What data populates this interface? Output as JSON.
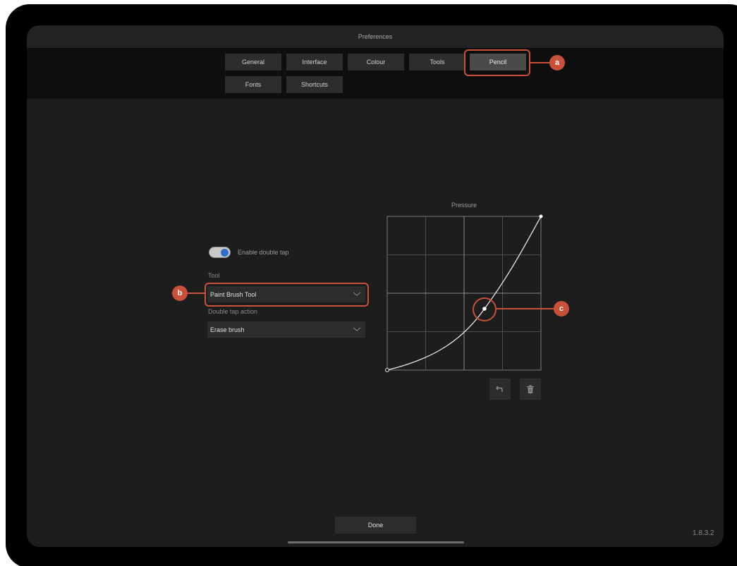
{
  "window": {
    "title": "Preferences"
  },
  "tabs": [
    {
      "label": "General"
    },
    {
      "label": "Interface"
    },
    {
      "label": "Colour"
    },
    {
      "label": "Tools"
    },
    {
      "label": "Pencil",
      "active": true
    },
    {
      "label": "Fonts"
    },
    {
      "label": "Shortcuts"
    }
  ],
  "callouts": {
    "a": "a",
    "b": "b",
    "c": "c",
    "color": "#c9513a"
  },
  "double_tap": {
    "toggle_label": "Enable double tap",
    "enabled": true
  },
  "tool": {
    "label": "Tool",
    "value": "Paint Brush Tool",
    "icon": "chevron-down-icon"
  },
  "double_tap_action": {
    "label": "Double tap action",
    "value": "Erase brush",
    "icon": "chevron-down-icon"
  },
  "pressure": {
    "title": "Pressure"
  },
  "curve_buttons": {
    "undo_icon": "undo-icon",
    "delete_icon": "trash-icon"
  },
  "footer": {
    "done_label": "Done",
    "version": "1.8.3.2"
  },
  "colors": {
    "accent_toggle": "#2c6fc9",
    "background": "#1c1d1c"
  }
}
